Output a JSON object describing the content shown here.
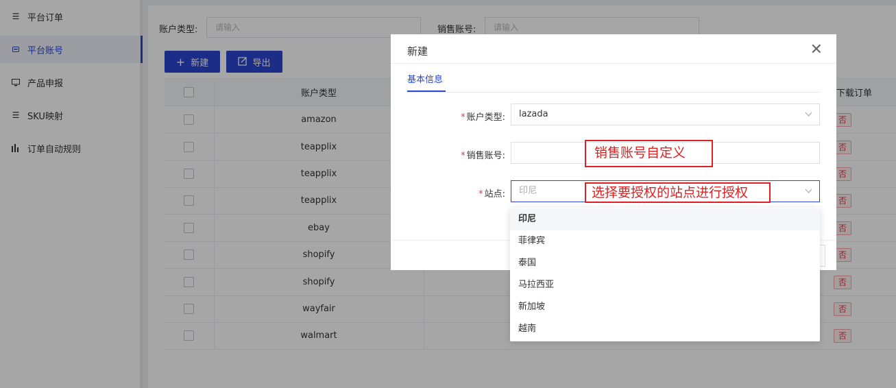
{
  "sidebar": {
    "items": [
      {
        "label": "平台订单",
        "icon": "menu-icon"
      },
      {
        "label": "平台账号",
        "icon": "account-icon"
      },
      {
        "label": "产品申报",
        "icon": "monitor-icon"
      },
      {
        "label": "SKU映射",
        "icon": "menu-icon"
      },
      {
        "label": "订单自动规则",
        "icon": "bar-chart-icon"
      }
    ],
    "active_index": 1
  },
  "filters": {
    "account_type_label": "账户类型:",
    "account_type_placeholder": "请输入",
    "sales_account_label": "销售账号:",
    "sales_account_placeholder": "请输入"
  },
  "toolbar": {
    "new_label": "新建",
    "export_label": "导出"
  },
  "table": {
    "header_account_type": "账户类型",
    "header_download": "下载订单",
    "rows": [
      {
        "type": "amazon",
        "download": "否"
      },
      {
        "type": "teapplix",
        "download": "否"
      },
      {
        "type": "teapplix",
        "download": "否"
      },
      {
        "type": "teapplix",
        "download": "否"
      },
      {
        "type": "ebay",
        "download": "否"
      },
      {
        "type": "shopify",
        "download": "否"
      },
      {
        "type": "shopify",
        "download": "否"
      },
      {
        "type": "wayfair",
        "download": "否"
      },
      {
        "type": "walmart",
        "download": "否"
      }
    ]
  },
  "modal": {
    "title": "新建",
    "tab": "基本信息",
    "required_mark": "*",
    "fields": {
      "account_type_label": "账户类型:",
      "account_type_value": "lazada",
      "sales_account_label": "销售账号:",
      "sales_account_value": "",
      "site_label": "站点:",
      "site_placeholder": "印尼"
    }
  },
  "dropdown": {
    "options": [
      "印尼",
      "菲律宾",
      "泰国",
      "马拉西亚",
      "新加坡",
      "越南"
    ],
    "selected_index": 0
  },
  "annotations": {
    "sales_account_note": "销售账号自定义",
    "site_note": "选择要授权的站点进行授权"
  },
  "colors": {
    "primary": "#2b45d2",
    "danger": "#e0394f",
    "annotation": "#e02020"
  }
}
